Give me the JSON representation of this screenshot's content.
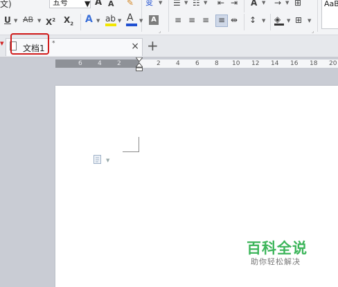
{
  "ribbon": {
    "font_name_partial": "文)",
    "font_size": "五号",
    "styles_preview": "AaBl"
  },
  "tab": {
    "title": "文档1",
    "modified_mark": "*"
  },
  "ruler": {
    "ticks_left": [
      "6",
      "4",
      "2"
    ],
    "ticks_right": [
      "2",
      "4",
      "6",
      "8",
      "10",
      "12",
      "14",
      "16",
      "18",
      "20"
    ]
  },
  "watermark": {
    "title": "百科全说",
    "subtitle": "助你轻松解决"
  },
  "colors": {
    "highlight_outline": "#d11c1c",
    "watermark_green": "#3cb55a",
    "font_color_bar": "#1f4fd1",
    "highlight_bar": "#f2e600"
  }
}
